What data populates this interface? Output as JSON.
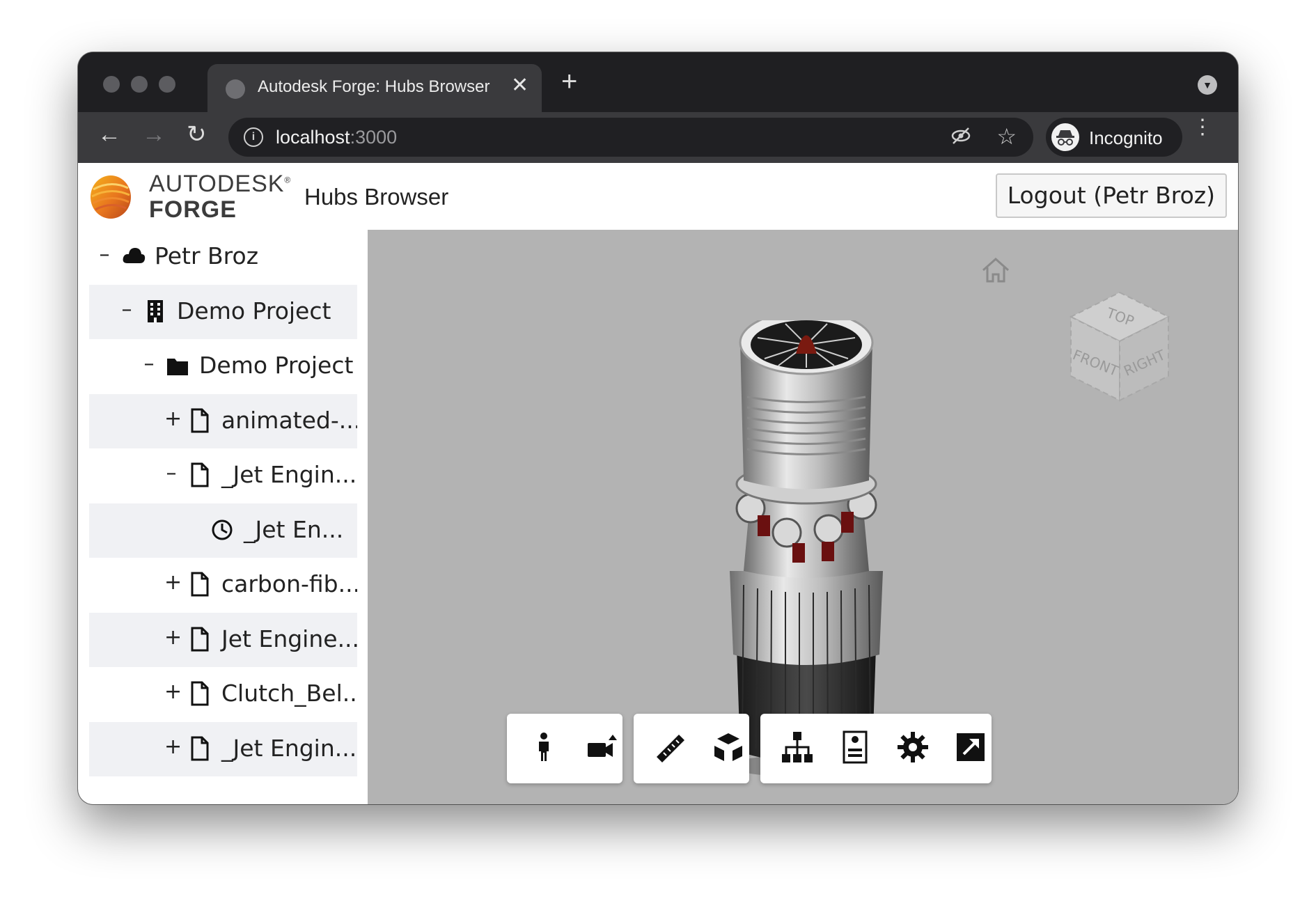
{
  "browser": {
    "tab_title": "Autodesk Forge: Hubs Browser",
    "url_host": "localhost",
    "url_port": ":3000",
    "profile_label": "Incognito"
  },
  "header": {
    "logo_line1": "AUTODESK",
    "logo_registered": "®",
    "logo_line2": "FORGE",
    "app_title": "Hubs Browser",
    "logout_label": "Logout (Petr Broz)"
  },
  "tree": {
    "items": [
      {
        "toggle": "–",
        "icon": "cloud-icon",
        "label": "Petr Broz"
      },
      {
        "toggle": "–",
        "icon": "building-icon",
        "label": "Demo Project"
      },
      {
        "toggle": "–",
        "icon": "folder-icon",
        "label": "Demo Project"
      },
      {
        "toggle": "+",
        "icon": "file-icon",
        "label": "animated-..."
      },
      {
        "toggle": "–",
        "icon": "file-icon",
        "label": "_Jet Engin..."
      },
      {
        "toggle": "",
        "icon": "clock-icon",
        "label": "_Jet En..."
      },
      {
        "toggle": "+",
        "icon": "file-icon",
        "label": "carbon-fib..."
      },
      {
        "toggle": "+",
        "icon": "file-icon",
        "label": "Jet Engine..."
      },
      {
        "toggle": "+",
        "icon": "file-icon",
        "label": "Clutch_Bel..."
      },
      {
        "toggle": "+",
        "icon": "file-icon",
        "label": "_Jet Engin..."
      }
    ]
  },
  "viewcube": {
    "top": "TOP",
    "front": "FRONT",
    "right": "RIGHT"
  },
  "viewer_toolbar": {
    "groups": [
      [
        "first-person-icon",
        "camera-icon"
      ],
      [
        "measure-icon",
        "explode-icon"
      ],
      [
        "model-browser-icon",
        "properties-icon",
        "settings-icon",
        "fullscreen-icon"
      ]
    ]
  },
  "colors": {
    "viewer_background": "#b3b3b3",
    "tree_shade": "#f0f1f4",
    "browser_chrome": "#3a3a3d"
  }
}
